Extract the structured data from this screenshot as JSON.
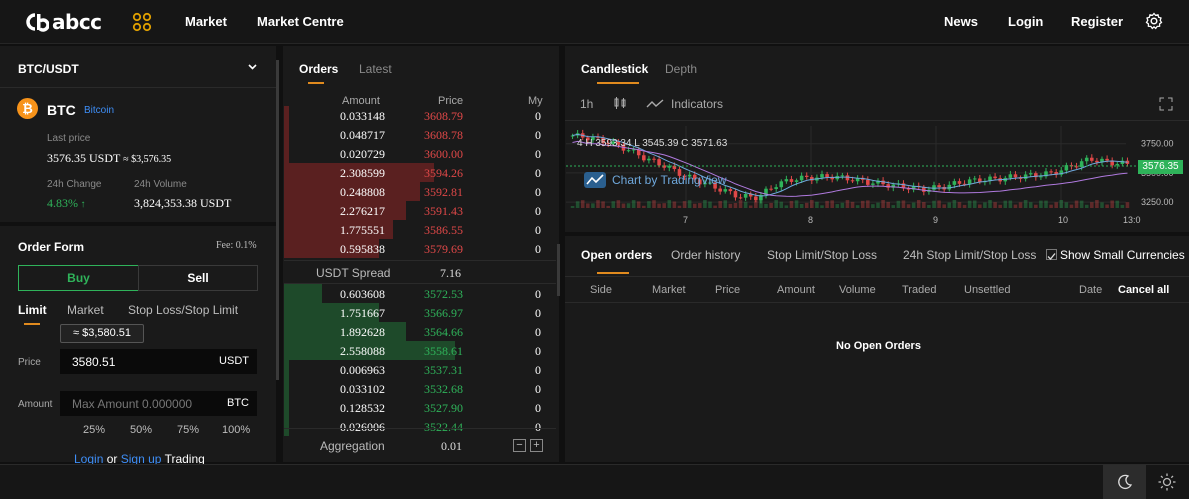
{
  "nav": {
    "brand": "abcc",
    "links": [
      "Market",
      "Market Centre"
    ],
    "right_links": [
      "News",
      "Login",
      "Register"
    ]
  },
  "pair": {
    "title": "BTC/USDT",
    "symbol": "BTC",
    "name": "Bitcoin",
    "last_price_label": "Last price",
    "last_price": "3576.35 USDT",
    "last_price_fiat": "≈ $3,576.35",
    "change_label": "24h Change",
    "change_value": "4.83%",
    "volume_label": "24h Volume",
    "volume_value": "3,824,353.38 USDT"
  },
  "order_form": {
    "title": "Order Form",
    "fee": "Fee: 0.1%",
    "buy": "Buy",
    "sell": "Sell",
    "types": [
      "Limit",
      "Market",
      "Stop Loss/Stop Limit"
    ],
    "tooltip": "≈ $3,580.51",
    "price_label": "Price",
    "price_value": "3580.51",
    "price_unit": "USDT",
    "amount_label": "Amount",
    "amount_placeholder": "Max Amount 0.000000",
    "amount_unit": "BTC",
    "percents": [
      "25%",
      "50%",
      "75%",
      "100%"
    ],
    "login": "Login",
    "or": "or",
    "signup": "Sign up",
    "trading": "Trading"
  },
  "orderbook": {
    "tabs": [
      "Orders",
      "Latest"
    ],
    "headers": [
      "Amount",
      "Price",
      "My"
    ],
    "asks": [
      {
        "amount": "0.033148",
        "price": "3608.79",
        "my": "0",
        "depth": 0.02
      },
      {
        "amount": "0.048717",
        "price": "3608.78",
        "my": "0",
        "depth": 0.02
      },
      {
        "amount": "0.020729",
        "price": "3600.00",
        "my": "0",
        "depth": 0.02
      },
      {
        "amount": "2.308599",
        "price": "3594.26",
        "my": "0",
        "depth": 0.55
      },
      {
        "amount": "0.248808",
        "price": "3592.81",
        "my": "0",
        "depth": 0.5
      },
      {
        "amount": "2.276217",
        "price": "3591.43",
        "my": "0",
        "depth": 0.45
      },
      {
        "amount": "1.775551",
        "price": "3586.55",
        "my": "0",
        "depth": 0.4
      },
      {
        "amount": "0.595838",
        "price": "3579.69",
        "my": "0",
        "depth": 0.35
      }
    ],
    "spread_label": "USDT Spread",
    "spread_value": "7.16",
    "bids": [
      {
        "amount": "0.603608",
        "price": "3572.53",
        "my": "0",
        "depth": 0.14
      },
      {
        "amount": "1.751667",
        "price": "3566.97",
        "my": "0",
        "depth": 0.35
      },
      {
        "amount": "1.892628",
        "price": "3564.66",
        "my": "0",
        "depth": 0.45
      },
      {
        "amount": "2.558088",
        "price": "3558.61",
        "my": "0",
        "depth": 0.63
      },
      {
        "amount": "0.006963",
        "price": "3537.31",
        "my": "0",
        "depth": 0.02
      },
      {
        "amount": "0.033102",
        "price": "3532.68",
        "my": "0",
        "depth": 0.02
      },
      {
        "amount": "0.128532",
        "price": "3527.90",
        "my": "0",
        "depth": 0.02
      },
      {
        "amount": "0.026006",
        "price": "3522.44",
        "my": "0",
        "depth": 0.02
      }
    ],
    "aggregation_label": "Aggregation",
    "aggregation_value": "0.01"
  },
  "chart": {
    "tabs": [
      "Candlestick",
      "Depth"
    ],
    "interval": "1h",
    "indicators": "Indicators",
    "ohlc_text": "4 H 3593.34 L 3545.39 C 3571.63",
    "watermark": "Chart by TradingView",
    "price_ticks": [
      "3750.00",
      "3500.00",
      "3250.00"
    ],
    "current_price": "3576.35",
    "date_ticks": [
      "7",
      "8",
      "9",
      "10",
      "13:0"
    ],
    "up_color": "#2fb35a",
    "down_color": "#e04848"
  },
  "open_orders": {
    "tabs": [
      "Open orders",
      "Order history",
      "Stop Limit/Stop Loss",
      "24h Stop Limit/Stop Loss"
    ],
    "show_small": "Show Small Currencies",
    "columns": [
      "Side",
      "Market",
      "Price",
      "Amount",
      "Volume",
      "Traded",
      "Unsettled",
      "Date"
    ],
    "cancel_all": "Cancel all",
    "empty": "No Open Orders"
  }
}
